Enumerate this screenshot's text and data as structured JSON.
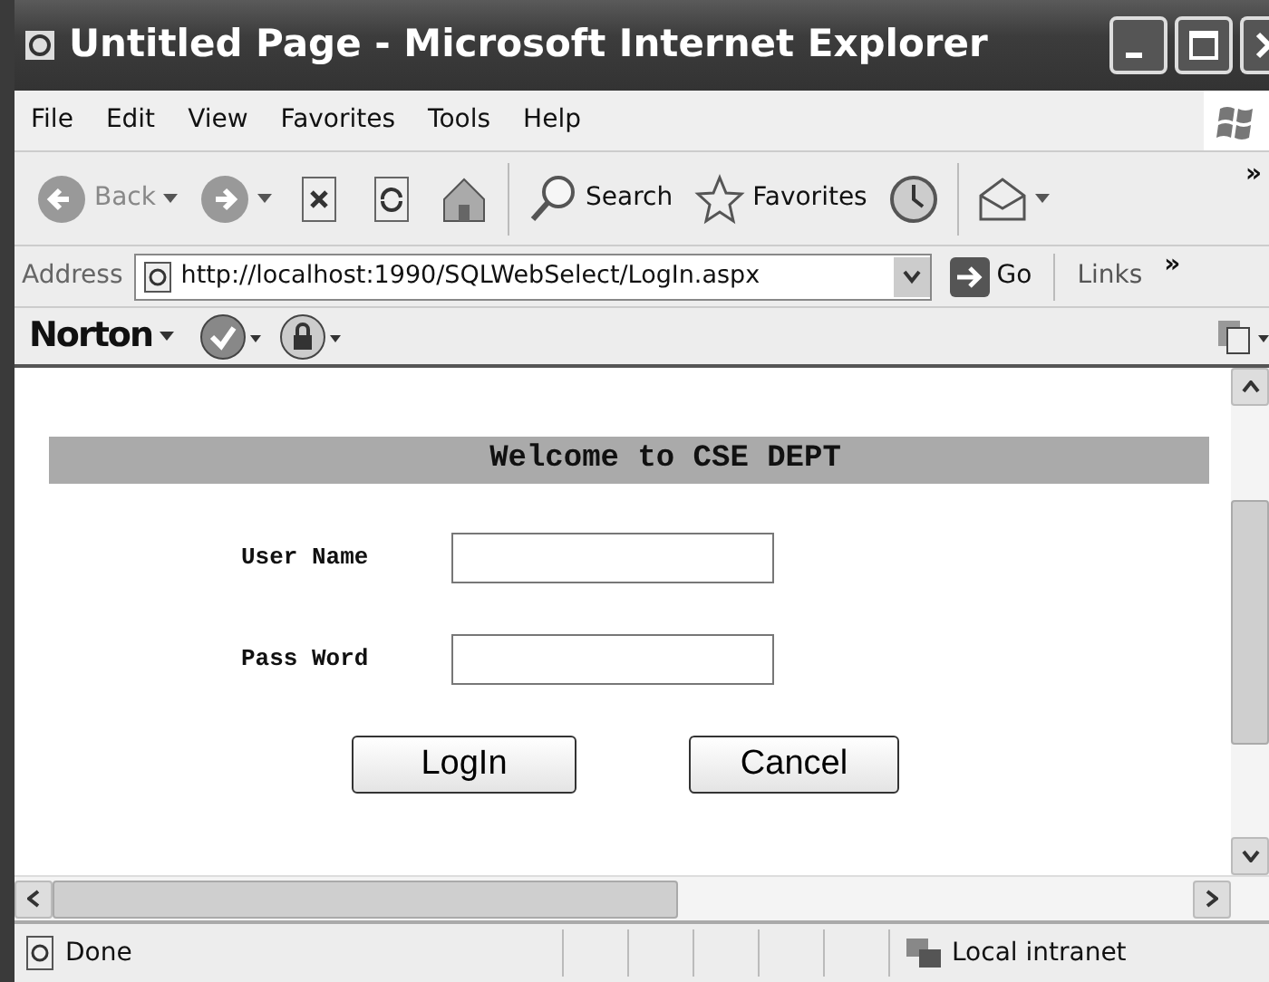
{
  "window": {
    "title": "Untitled Page - Microsoft Internet Explorer"
  },
  "menu": [
    {
      "label": "File"
    },
    {
      "label": "Edit"
    },
    {
      "label": "View"
    },
    {
      "label": "Favorites"
    },
    {
      "label": "Tools"
    },
    {
      "label": "Help"
    }
  ],
  "toolbar": [
    {
      "kind": "back",
      "label": "Back",
      "dropdown": true
    },
    {
      "kind": "forward",
      "dropdown": true
    },
    {
      "kind": "stop",
      "dropdown": false
    },
    {
      "kind": "refresh",
      "dropdown": false
    },
    {
      "kind": "home",
      "dropdown": false
    },
    {
      "kind": "search",
      "label": "Search",
      "dropdown": false
    },
    {
      "kind": "favorites",
      "label": "Favorites",
      "dropdown": false
    },
    {
      "kind": "history",
      "dropdown": false
    },
    {
      "kind": "mail",
      "dropdown": true
    }
  ],
  "toolbar_more": "»",
  "address_bar": {
    "label": "Address",
    "url": "http://localhost:1990/SQLWebSelect/LogIn.aspx",
    "go": "Go",
    "links": "Links",
    "more": "»"
  },
  "norton_bar": {
    "label": "Norton"
  },
  "page": {
    "heading": "Welcome to CSE DEPT",
    "fields": [
      {
        "label": "User Name"
      },
      {
        "label": "Pass Word"
      }
    ],
    "buttons": [
      "LogIn",
      "Cancel"
    ]
  },
  "status_bar": {
    "text": "Done",
    "zone": "Local intranet"
  }
}
